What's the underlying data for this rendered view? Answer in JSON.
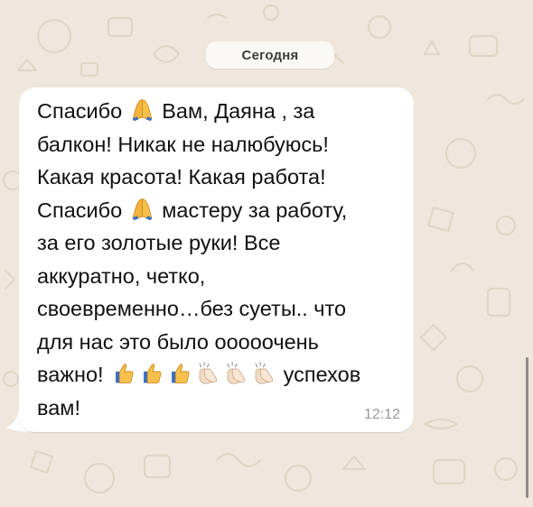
{
  "chat": {
    "date_separator": "Сегодня",
    "message": {
      "lines": [
        [
          "Спасибо ",
          {
            "emoji": "folded-hands-icon"
          },
          " Вам, Даяна , за"
        ],
        [
          "балкон! Никак не налюбуюсь!"
        ],
        [
          "Какая красота! Какая работа!"
        ],
        [
          "Спасибо ",
          {
            "emoji": "folded-hands-icon"
          },
          " мастеру за работу,"
        ],
        [
          "за его золотые руки! Все"
        ],
        [
          "аккуратно, четко,"
        ],
        [
          "своевременно…без суеты.. что"
        ],
        [
          "для нас это было ооооочень"
        ],
        [
          "важно! ",
          {
            "emoji": "thumbs-up-icon"
          },
          {
            "emoji": "thumbs-up-icon"
          },
          {
            "emoji": "thumbs-up-icon"
          },
          {
            "emoji": "clapping-hands-icon"
          },
          {
            "emoji": "clapping-hands-icon"
          },
          {
            "emoji": "clapping-hands-icon"
          },
          " успехов"
        ],
        [
          "вам!"
        ]
      ],
      "time": "12:12"
    }
  },
  "colors": {
    "wallpaper": "#efe7dd",
    "bubble": "#ffffff",
    "date_chip": "#fbf9f5",
    "text": "#111111",
    "time": "#9a9a9a"
  }
}
